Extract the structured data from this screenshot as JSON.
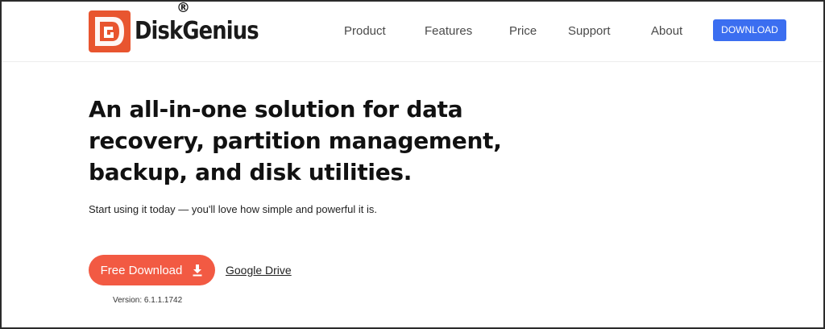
{
  "brand": {
    "name": "DiskGenius",
    "registered_mark": "®",
    "logo_color": "#e8552f"
  },
  "nav": {
    "items": [
      {
        "label": "Product"
      },
      {
        "label": "Features"
      },
      {
        "label": "Price"
      },
      {
        "label": "Support"
      },
      {
        "label": "About"
      }
    ],
    "download_label": "DOWNLOAD",
    "download_color": "#3b6ef0"
  },
  "hero": {
    "title": "An all-in-one solution for data recovery, partition management, backup, and disk utilities.",
    "subtitle": "Start using it today — you'll love how simple and powerful it is.",
    "free_download_label": "Free Download",
    "free_download_icon": "download-arrow-icon",
    "free_download_color": "#f25a43",
    "google_drive_label": "Google Drive",
    "version": "Version: 6.1.1.1742"
  }
}
